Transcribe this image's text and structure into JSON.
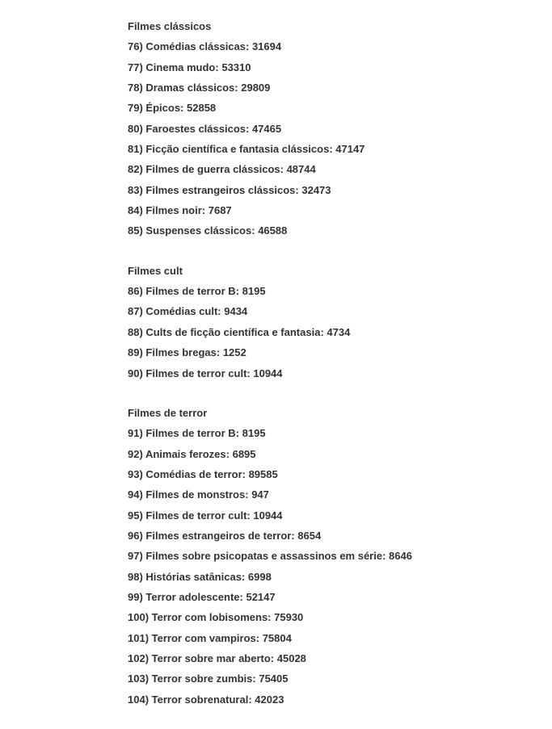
{
  "sections": [
    {
      "title": "Filmes clássicos",
      "items": [
        {
          "num": "76",
          "label": "Comédias clássicas",
          "code": "31694"
        },
        {
          "num": "77",
          "label": "Cinema mudo",
          "code": "53310"
        },
        {
          "num": "78",
          "label": "Dramas clássicos",
          "code": "29809"
        },
        {
          "num": "79",
          "label": "Épicos",
          "code": "52858"
        },
        {
          "num": "80",
          "label": "Faroestes clássicos",
          "code": "47465"
        },
        {
          "num": "81",
          "label": "Ficção científica e fantasia clássicos",
          "code": "47147"
        },
        {
          "num": "82",
          "label": "Filmes de guerra clássicos",
          "code": "48744"
        },
        {
          "num": "83",
          "label": "Filmes estrangeiros clássicos",
          "code": "32473"
        },
        {
          "num": "84",
          "label": "Filmes noir",
          "code": "7687"
        },
        {
          "num": "85",
          "label": "Suspenses clássicos",
          "code": "46588"
        }
      ]
    },
    {
      "title": "Filmes cult",
      "items": [
        {
          "num": "86",
          "label": "Filmes de terror B",
          "code": "8195"
        },
        {
          "num": "87",
          "label": "Comédias cult",
          "code": "9434"
        },
        {
          "num": "88",
          "label": "Cults de ficção científica e fantasia",
          "code": "4734"
        },
        {
          "num": "89",
          "label": "Filmes bregas",
          "code": "1252"
        },
        {
          "num": "90",
          "label": "Filmes de terror cult",
          "code": "10944"
        }
      ]
    },
    {
      "title": "Filmes de terror",
      "items": [
        {
          "num": "91",
          "label": "Filmes de terror B",
          "code": "8195"
        },
        {
          "num": "92",
          "label": "Animais ferozes",
          "code": "6895"
        },
        {
          "num": "93",
          "label": "Comédias de terror",
          "code": "89585"
        },
        {
          "num": "94",
          "label": "Filmes de monstros",
          "code": "947"
        },
        {
          "num": "95",
          "label": "Filmes de terror cult",
          "code": "10944"
        },
        {
          "num": "96",
          "label": "Filmes estrangeiros de terror",
          "code": "8654"
        },
        {
          "num": "97",
          "label": "Filmes sobre psicopatas e assassinos em série",
          "code": "8646"
        },
        {
          "num": "98",
          "label": "Histórias satânicas",
          "code": "6998"
        },
        {
          "num": "99",
          "label": "Terror adolescente",
          "code": "52147"
        },
        {
          "num": "100",
          "label": "Terror com lobisomens",
          "code": "75930"
        },
        {
          "num": "101",
          "label": "Terror com vampiros",
          "code": "75804"
        },
        {
          "num": "102",
          "label": "Terror sobre mar aberto",
          "code": "45028"
        },
        {
          "num": "103",
          "label": "Terror sobre zumbis",
          "code": "75405"
        },
        {
          "num": "104",
          "label": "Terror sobrenatural",
          "code": "42023"
        }
      ]
    }
  ]
}
